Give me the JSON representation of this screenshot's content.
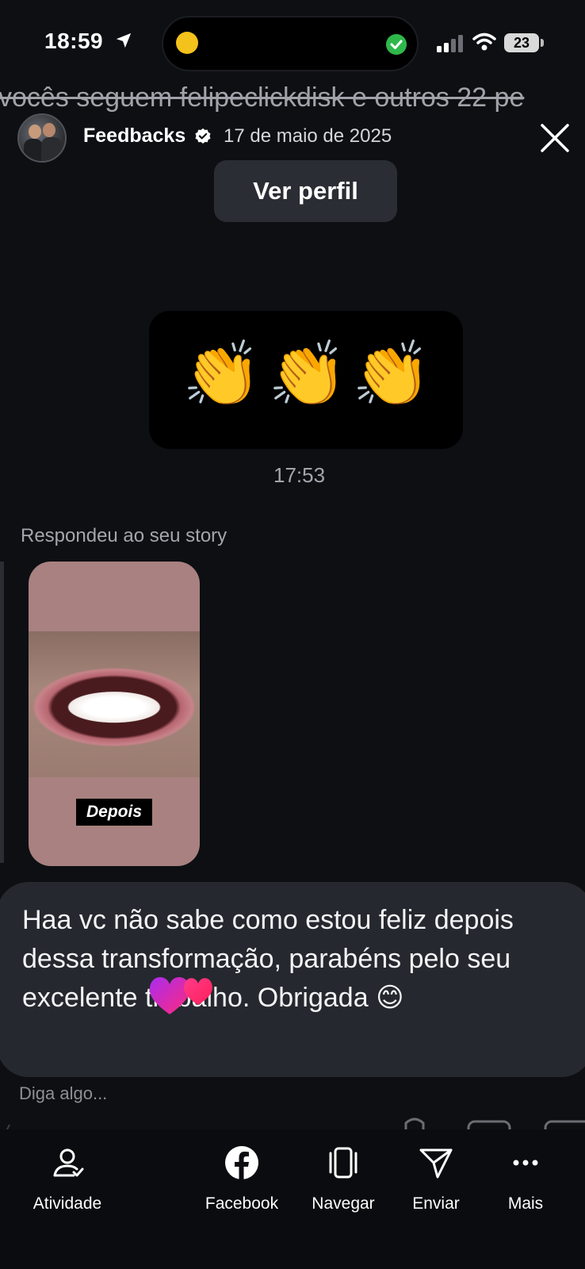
{
  "status_bar": {
    "time": "18:59",
    "battery": "23"
  },
  "story": {
    "marquee_text": "vocês seguem felipeclickdisk e outros 22 pe",
    "username": "Feedbacks",
    "date": "17 de maio de 2025",
    "profile_button": "Ver perfil"
  },
  "messages": {
    "clap_emoji": "👏",
    "clap_time": "17:53",
    "reply_label": "Respondeu ao seu story",
    "story_tag": "Depois",
    "text_message": "Haa vc não sabe como estou feliz depois dessa transformação, parabéns pelo seu excelente trabalho. Obrigada 😊",
    "composer_placeholder": "Diga algo..."
  },
  "bottom_nav": {
    "items": [
      {
        "label": "Atividade",
        "icon": "activity-icon"
      },
      {
        "label": "Facebook",
        "icon": "facebook-icon"
      },
      {
        "label": "Navegar",
        "icon": "browse-icon"
      },
      {
        "label": "Enviar",
        "icon": "send-icon"
      },
      {
        "label": "Mais",
        "icon": "more-icon"
      }
    ]
  },
  "colors": {
    "background": "#0d0f13",
    "bubble": "#25282e",
    "story_card": "#a88180",
    "verified": "#ffffff"
  }
}
